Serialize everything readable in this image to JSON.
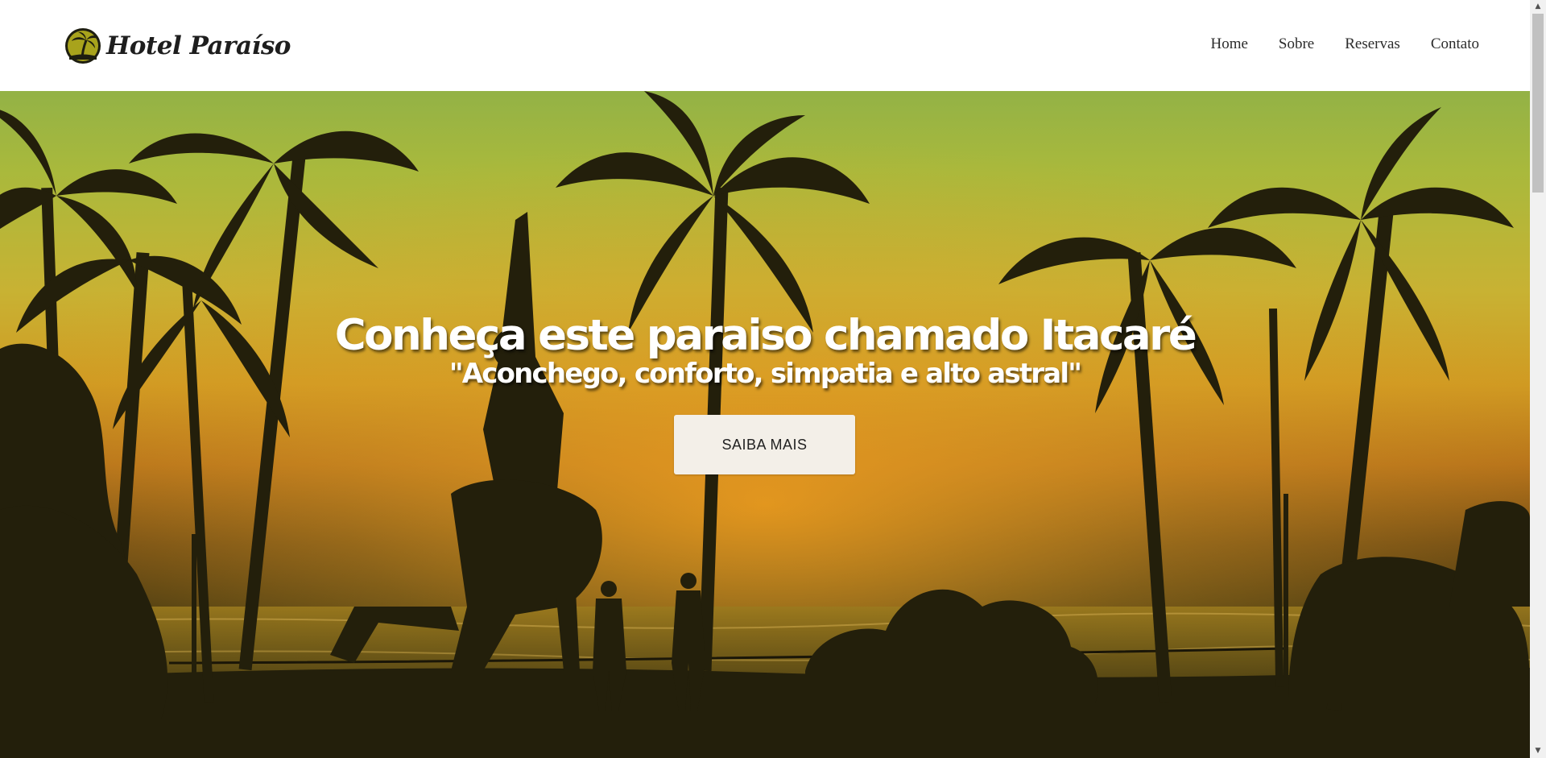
{
  "header": {
    "brand": "Hotel Paraíso",
    "logo_icon": "palm-tree-badge-icon",
    "nav": [
      {
        "label": "Home"
      },
      {
        "label": "Sobre"
      },
      {
        "label": "Reservas"
      },
      {
        "label": "Contato"
      }
    ]
  },
  "hero": {
    "title": "Conheça este paraiso chamado Itacaré",
    "subtitle": "\"Aconchego, conforto, simpatia e alto astral\"",
    "button_label": "SAIBA MAIS",
    "background_description_colors": {
      "sky_top": "#93b246",
      "sunset": "#d09a22",
      "silhouette": "#231f0b"
    }
  },
  "scrollbar": {
    "up_icon": "scroll-up-arrow-icon",
    "down_icon": "scroll-down-arrow-icon"
  }
}
